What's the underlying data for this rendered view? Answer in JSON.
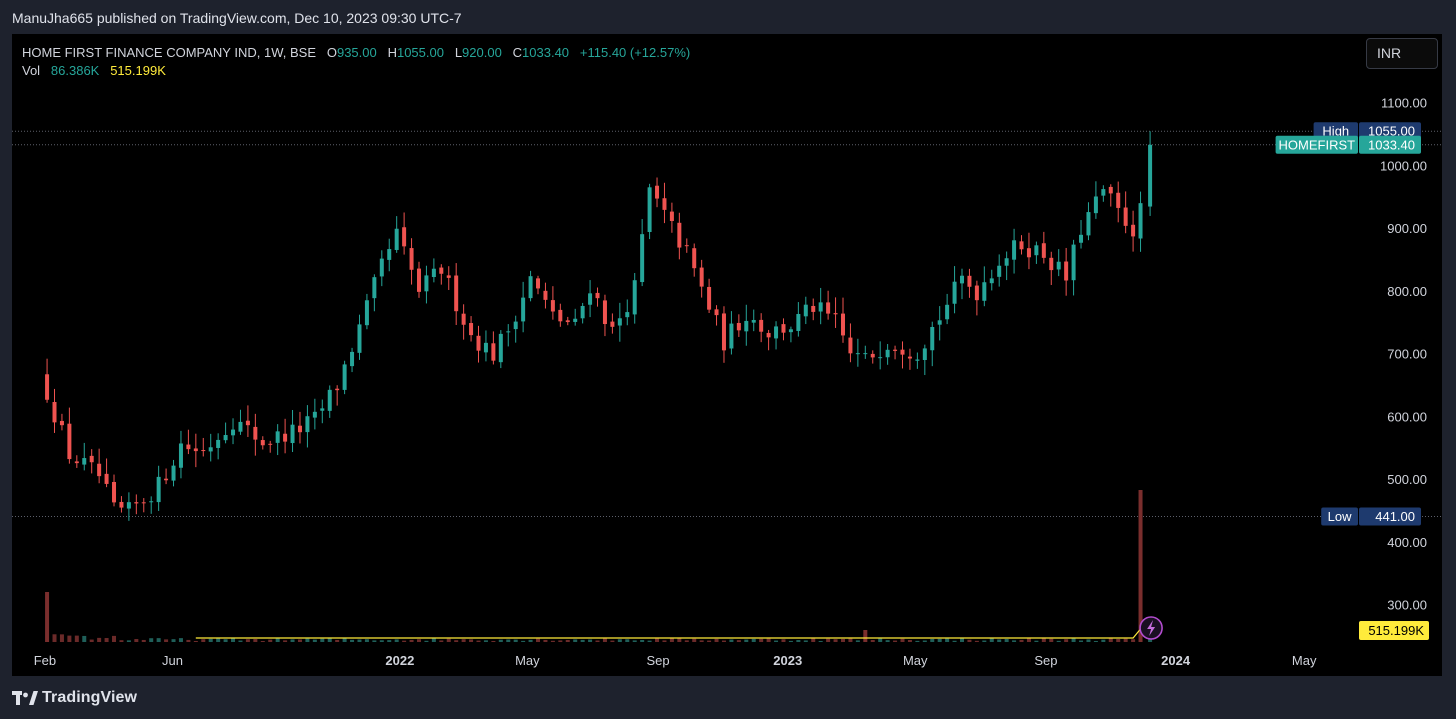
{
  "header": {
    "published": "ManuJha665 published on TradingView.com, Dec 10, 2023 09:30 UTC-7"
  },
  "legend": {
    "symbol": "HOME FIRST FINANCE COMPANY IND, 1W, BSE",
    "o_label": "O",
    "open": "935.00",
    "h_label": "H",
    "high": "1055.00",
    "l_label": "L",
    "low": "920.00",
    "c_label": "C",
    "close": "1033.40",
    "change": "+115.40 (+12.57%)",
    "vol_label": "Vol",
    "vol": "86.386K",
    "vol_ma": "515.199K"
  },
  "currency": "INR",
  "footer": {
    "brand": "TradingView",
    "brand_icon": "tradingview-logo-icon"
  },
  "colors": {
    "up": "#26a69a",
    "down": "#ef5350",
    "background": "#000000",
    "ma_line": "#ffeb3b",
    "label_navy": "#1e3a6e"
  },
  "chart_data": {
    "type": "candlestick",
    "interval": "1W",
    "y_range": [
      240,
      1090
    ],
    "y_ticks": [
      "1100.00",
      "1000.00",
      "900.00",
      "800.00",
      "700.00",
      "600.00",
      "500.00",
      "400.00",
      "300.00"
    ],
    "x_ticks": [
      "Feb",
      "Jun",
      "2022",
      "May",
      "Sep",
      "2023",
      "May",
      "Sep",
      "2024",
      "May"
    ],
    "x_tick_dates": [
      "2021-02-01",
      "2021-06-01",
      "2022-01-01",
      "2022-05-01",
      "2022-09-01",
      "2023-01-01",
      "2023-05-01",
      "2023-09-01",
      "2024-01-01",
      "2024-05-01"
    ],
    "x_tick_bold": [
      false,
      false,
      true,
      false,
      false,
      true,
      false,
      false,
      true,
      false
    ],
    "x_range": [
      "2021-01-01",
      "2024-06-15"
    ],
    "price_labels": [
      {
        "name": "High",
        "value": 1055.0,
        "text": "1055.00",
        "kind": "navy",
        "line": true
      },
      {
        "name": "HOMEFIRST",
        "value": 1033.4,
        "text": "1033.40",
        "kind": "teal",
        "line": true
      },
      {
        "name": "Low",
        "value": 441.0,
        "text": "441.00",
        "kind": "navy",
        "line": true
      }
    ],
    "volume_ma_label": "515.199K",
    "anchor_points": [
      [
        "2021-02-03",
        640
      ],
      [
        "2021-02-24",
        540
      ],
      [
        "2021-03-24",
        505
      ],
      [
        "2021-04-07",
        450
      ],
      [
        "2021-04-21",
        448
      ],
      [
        "2021-05-19",
        490
      ],
      [
        "2021-06-09",
        555
      ],
      [
        "2021-06-30",
        545
      ],
      [
        "2021-07-28",
        595
      ],
      [
        "2021-08-25",
        560
      ],
      [
        "2021-09-22",
        575
      ],
      [
        "2021-10-13",
        595
      ],
      [
        "2021-11-03",
        650
      ],
      [
        "2021-11-24",
        740
      ],
      [
        "2021-12-15",
        840
      ],
      [
        "2021-12-29",
        890
      ],
      [
        "2022-01-19",
        800
      ],
      [
        "2022-02-09",
        835
      ],
      [
        "2022-03-09",
        730
      ],
      [
        "2022-03-30",
        700
      ],
      [
        "2022-04-13",
        740
      ],
      [
        "2022-05-04",
        820
      ],
      [
        "2022-05-25",
        760
      ],
      [
        "2022-06-15",
        745
      ],
      [
        "2022-06-29",
        810
      ],
      [
        "2022-07-20",
        735
      ],
      [
        "2022-08-10",
        805
      ],
      [
        "2022-08-24",
        960
      ],
      [
        "2022-09-07",
        920
      ],
      [
        "2022-09-28",
        860
      ],
      [
        "2022-10-19",
        775
      ],
      [
        "2022-11-02",
        720
      ],
      [
        "2022-11-23",
        765
      ],
      [
        "2022-12-14",
        735
      ],
      [
        "2023-01-04",
        745
      ],
      [
        "2023-01-25",
        775
      ],
      [
        "2023-02-15",
        750
      ],
      [
        "2023-03-01",
        700
      ],
      [
        "2023-03-15",
        690
      ],
      [
        "2023-04-05",
        720
      ],
      [
        "2023-05-03",
        705
      ],
      [
        "2023-05-24",
        760
      ],
      [
        "2023-06-14",
        820
      ],
      [
        "2023-06-28",
        800
      ],
      [
        "2023-07-19",
        850
      ],
      [
        "2023-08-09",
        875
      ],
      [
        "2023-08-30",
        860
      ],
      [
        "2023-09-20",
        820
      ],
      [
        "2023-10-04",
        900
      ],
      [
        "2023-10-25",
        960
      ],
      [
        "2023-11-08",
        925
      ],
      [
        "2023-11-22",
        900
      ],
      [
        "2023-12-01",
        935
      ],
      [
        "2023-12-08",
        1033.4
      ]
    ],
    "last_candle": {
      "date": "2023-12-08",
      "open": 935.0,
      "high": 1055.0,
      "low": 920.0,
      "close": 1033.4
    },
    "volume_spikes": [
      {
        "date": "2021-02-03",
        "volume": "high",
        "color": "down"
      },
      {
        "date": "2023-03-15",
        "volume": "medium",
        "color": "down"
      },
      {
        "date": "2023-12-01",
        "volume": "extreme",
        "color": "down"
      }
    ]
  }
}
